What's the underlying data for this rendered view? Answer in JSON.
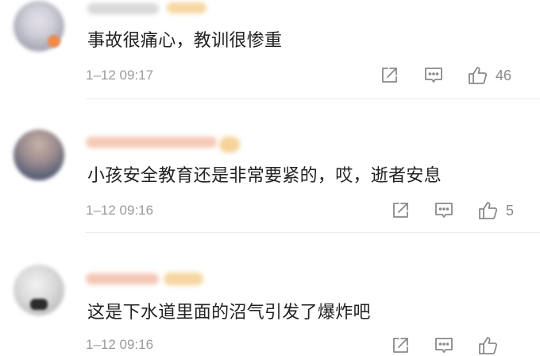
{
  "comments": [
    {
      "text": "事故很痛心，教训很惨重",
      "time": "1–12 09:17",
      "likes": "46",
      "icons": [
        "share-icon",
        "reply-icon",
        "like-icon"
      ]
    },
    {
      "text": "小孩安全教育还是非常要紧的，哎，逝者安息",
      "time": "1–12 09:16",
      "likes": "5",
      "icons": [
        "share-icon",
        "reply-icon",
        "like-icon"
      ]
    },
    {
      "text": "这是下水道里面的沼气引发了爆炸吧",
      "time": "1–12 09:16",
      "likes": "",
      "icons": [
        "share-icon",
        "reply-icon",
        "like-icon"
      ]
    }
  ],
  "colors": {
    "text": "#222222",
    "meta": "#9a9a9a",
    "icon": "#8a8a8a",
    "divider": "#ececec"
  }
}
